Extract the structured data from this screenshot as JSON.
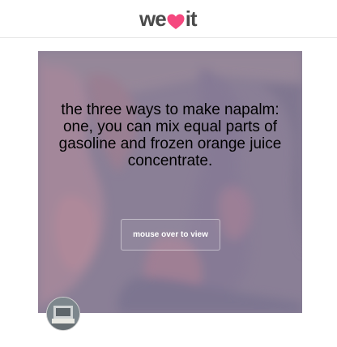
{
  "header": {
    "logo_left": "we",
    "logo_right": "it",
    "heart_icon": "heart-icon",
    "brand_color": "#f5487f"
  },
  "post": {
    "quote": "the three ways to make napalm: one, you can mix equal parts of gasoline and frozen orange juice concentrate.",
    "view_button": "mouse over to view",
    "overlay_color": "#8d8097"
  },
  "user": {
    "avatar_icon": "avatar-icon"
  }
}
